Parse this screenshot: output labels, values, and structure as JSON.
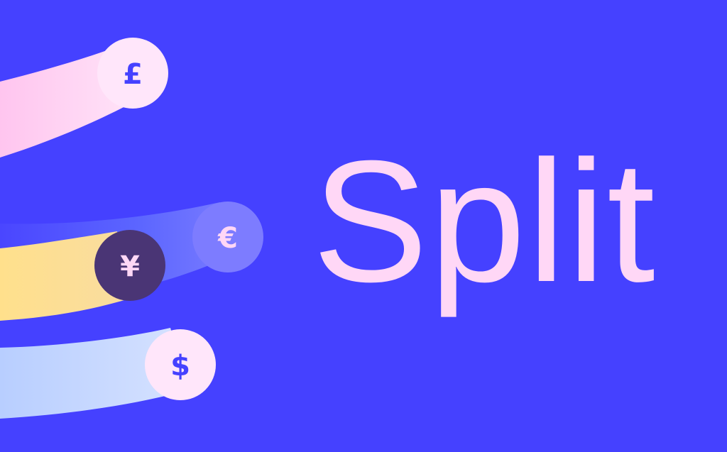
{
  "title": "Split",
  "colors": {
    "background": "#4541FF",
    "title": "#FFD7F6",
    "coin_light": "#FFE6FA",
    "coin_dark": "#4A3575",
    "coin_glyph": "#4541FF",
    "coin_glyph_light": "#FFD7F6"
  },
  "coins": [
    {
      "name": "pound",
      "symbol": "£"
    },
    {
      "name": "euro",
      "symbol": "€"
    },
    {
      "name": "yen",
      "symbol": "¥"
    },
    {
      "name": "dollar",
      "symbol": "$"
    }
  ]
}
